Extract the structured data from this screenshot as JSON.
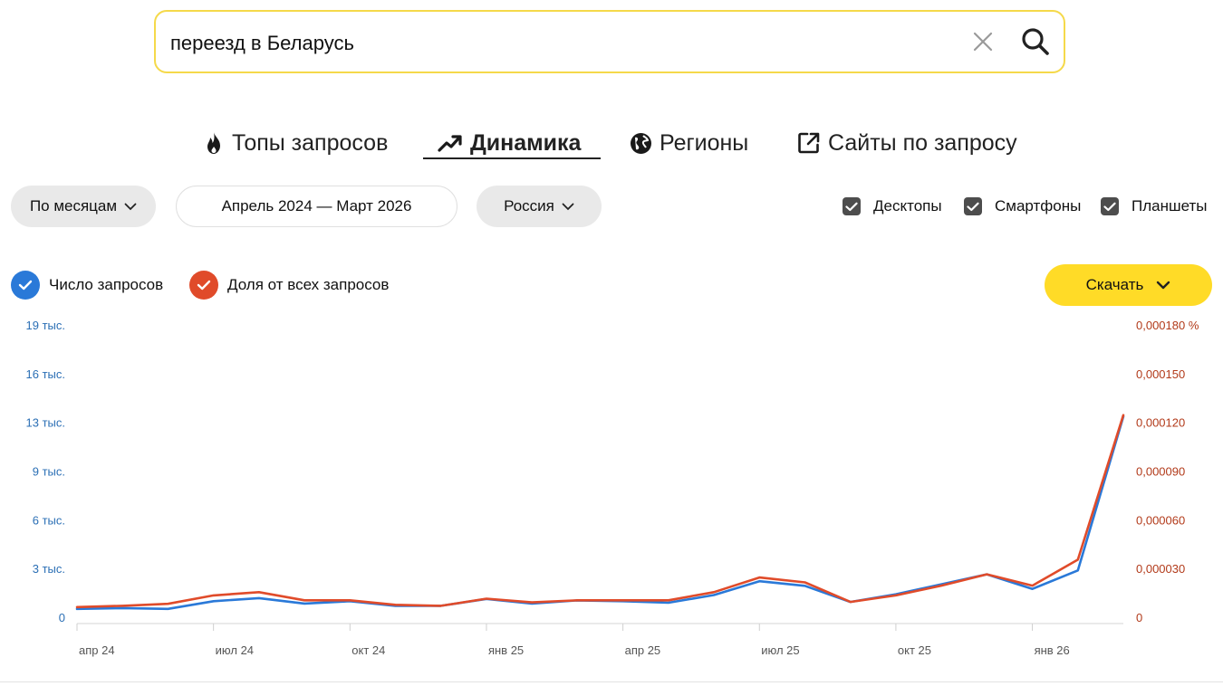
{
  "search": {
    "query": "переезд в Беларусь"
  },
  "tabs": [
    {
      "label": "Топы запросов",
      "icon": "flame-icon"
    },
    {
      "label": "Динамика",
      "icon": "trend-up-icon"
    },
    {
      "label": "Регионы",
      "icon": "globe-icon"
    },
    {
      "label": "Сайты по запросу",
      "icon": "external-link-icon"
    }
  ],
  "filters": {
    "period": "По месяцам",
    "date_range": "Апрель 2024 — Март 2026",
    "region": "Россия"
  },
  "devices": [
    {
      "label": "Десктопы",
      "checked": true
    },
    {
      "label": "Смартфоны",
      "checked": true
    },
    {
      "label": "Планшеты",
      "checked": true
    }
  ],
  "legend": {
    "count": "Число запросов",
    "share": "Доля от всех запросов"
  },
  "download_label": "Скачать",
  "colors": {
    "blue": "#2a79d8",
    "red": "#e04b2a",
    "accent": "#ffdb27",
    "right_axis": "#b23a1a",
    "left_axis": "#2b6fb5"
  },
  "chart_data": {
    "type": "line",
    "x": [
      "апр 24",
      "май 24",
      "июн 24",
      "июл 24",
      "авг 24",
      "сен 24",
      "окт 24",
      "ноя 24",
      "дек 24",
      "янв 25",
      "фев 25",
      "мар 25",
      "апр 25",
      "май 25",
      "июн 25",
      "июл 25",
      "авг 25",
      "сен 25",
      "окт 25",
      "ноя 25",
      "дек 25",
      "янв 26",
      "фев 26",
      "мар 26"
    ],
    "x_tick_labels": [
      "апр 24",
      "июл 24",
      "окт 24",
      "янв 25",
      "апр 25",
      "июл 25",
      "окт 25",
      "янв 26"
    ],
    "y_left_ticks": [
      "0",
      "3 тыс.",
      "6 тыс.",
      "9 тыс.",
      "13 тыс.",
      "16 тыс.",
      "19 тыс."
    ],
    "y_right_ticks": [
      "0",
      "0,000030",
      "0,000060",
      "0,000090",
      "0,000120",
      "0,000150",
      "0,000180 %"
    ],
    "series": [
      {
        "name": "Число запросов",
        "axis": "left",
        "values": [
          600,
          650,
          600,
          1100,
          1300,
          950,
          1100,
          800,
          800,
          1250,
          950,
          1150,
          1100,
          1000,
          1500,
          2400,
          2100,
          1050,
          1550,
          2200,
          2850,
          1900,
          3100,
          13100
        ]
      },
      {
        "name": "Доля от всех запросов",
        "axis": "right",
        "values": [
          6.8e-06,
          7.6e-06,
          8.8e-06,
          1.4e-05,
          1.6e-05,
          1.1e-05,
          1.1e-05,
          8.2e-06,
          7.6e-06,
          1.2e-05,
          9.7e-06,
          1.1e-05,
          1.1e-05,
          1.1e-05,
          1.6e-05,
          2.5e-05,
          2.2e-05,
          1e-05,
          1.4e-05,
          2e-05,
          2.7e-05,
          2e-05,
          3.6e-05,
          0.000125
        ]
      }
    ],
    "ylim_left": [
      0,
      19000
    ],
    "ylim_right": [
      0,
      0.00018
    ]
  }
}
